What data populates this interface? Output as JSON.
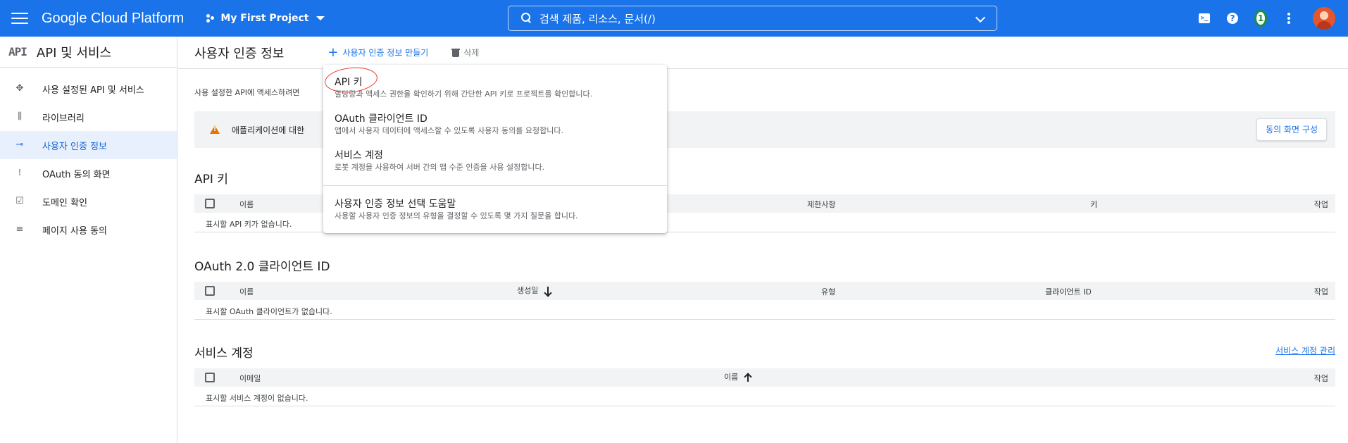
{
  "topbar": {
    "brand": "Google Cloud Platform",
    "project": "My First Project",
    "search_text": "검색   제품, 리소스, 문서(/)",
    "notification_count": "1",
    "colors": {
      "bar": "#1a73e8"
    }
  },
  "sidebar": {
    "title": "API 및 서비스",
    "logo": "API",
    "items": [
      {
        "label": "사용 설정된 API 및 서비스",
        "icon": "api-hub-icon"
      },
      {
        "label": "라이브러리",
        "icon": "library-icon"
      },
      {
        "label": "사용자 인증 정보",
        "icon": "key-icon",
        "active": true
      },
      {
        "label": "OAuth 동의 화면",
        "icon": "consent-icon"
      },
      {
        "label": "도메인 확인",
        "icon": "domain-check-icon"
      },
      {
        "label": "페이지 사용 동의",
        "icon": "page-usage-icon"
      }
    ]
  },
  "header": {
    "title": "사용자 인증 정보",
    "create_label": "사용자 인증 정보 만들기",
    "delete_label": "삭제"
  },
  "intro_text": "사용 설정한 API에 액세스하려면",
  "notice": {
    "text": "애플리케이션에 대한",
    "button": "동의 화면 구성"
  },
  "dropdown": {
    "items": [
      {
        "title": "API 키",
        "desc": "할당량과 액세스 권한을 확인하기 위해 간단한 API 키로 프로젝트를 확인합니다."
      },
      {
        "title": "OAuth 클라이언트 ID",
        "desc": "앱에서 사용자 데이터에 액세스할 수 있도록 사용자 동의를 요청합니다."
      },
      {
        "title": "서비스 계정",
        "desc": "로봇 계정을 사용하여 서버 간의 앱 수준 인증을 사용 설정합니다."
      },
      {
        "title": "사용자 인증 정보 선택 도움말",
        "desc": "사용할 사용자 인증 정보의 유형을 결정할 수 있도록 몇 가지 질문을 합니다."
      }
    ]
  },
  "api_keys": {
    "title": "API 키",
    "columns": [
      "이름",
      "제한사항",
      "키",
      "작업"
    ],
    "empty": "표시할 API 키가 없습니다."
  },
  "oauth": {
    "title": "OAuth 2.0 클라이언트 ID",
    "columns": [
      "이름",
      "생성일",
      "유형",
      "클라이언트 ID",
      "작업"
    ],
    "empty": "표시할 OAuth 클라이언트가 없습니다."
  },
  "service_accounts": {
    "title": "서비스 계정",
    "manage_link": "서비스 계정 관리",
    "columns": [
      "이메일",
      "이름",
      "작업"
    ],
    "empty": "표시할 서비스 계정이 없습니다."
  }
}
